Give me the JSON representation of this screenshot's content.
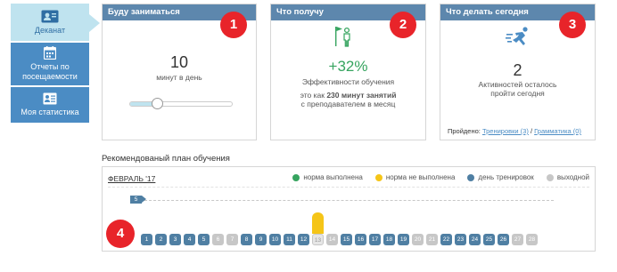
{
  "sidebar": {
    "items": [
      {
        "label": "Деканат",
        "icon": "id-card-icon",
        "active": true
      },
      {
        "label": "Отчеты по посещаемости",
        "icon": "calendar-icon",
        "active": false
      },
      {
        "label": "Моя статистика",
        "icon": "profile-card-icon",
        "active": false
      }
    ]
  },
  "cards": {
    "goal": {
      "title": "Буду заниматься",
      "badge": "1",
      "value": "10",
      "unit": "минут в день",
      "slider_fraction": 0.26
    },
    "result": {
      "title": "Что получу",
      "badge": "2",
      "icon": "flag-person-icon",
      "percent": "+32%",
      "percent_label": "Эффективности обучения",
      "detail_prefix": "это как ",
      "detail_bold": "230 минут занятий",
      "detail_suffix": "с преподавателем в месяц"
    },
    "today": {
      "title": "Что делать сегодня",
      "badge": "3",
      "icon": "running-person-icon",
      "value": "2",
      "label": "Активностей осталось пройти сегодня",
      "passed_label": "Пройдено:",
      "link_training": "Тренировки (3)",
      "link_separator": "/",
      "link_grammar": "Грамматика (0)"
    }
  },
  "plan": {
    "title": "Рекомендованый план обучения",
    "month": "ФЕВРАЛЬ '17",
    "week_marker": "5",
    "badge": "4",
    "legend": [
      {
        "label": "норма выполнена",
        "color": "#36a45f"
      },
      {
        "label": "норма не выполнена",
        "color": "#f5c518"
      },
      {
        "label": "день тренировок",
        "color": "#4f7fa3"
      },
      {
        "label": "выходной",
        "color": "#c7c7c7"
      }
    ],
    "colors": {
      "train": "#4f7fa3",
      "off": "#c7c7c7",
      "accent_red": "#e8242a",
      "header_blue": "#5d87ad"
    },
    "days": [
      {
        "n": "1",
        "type": "train"
      },
      {
        "n": "2",
        "type": "train"
      },
      {
        "n": "3",
        "type": "train"
      },
      {
        "n": "4",
        "type": "train"
      },
      {
        "n": "5",
        "type": "train"
      },
      {
        "n": "6",
        "type": "off"
      },
      {
        "n": "7",
        "type": "off"
      },
      {
        "n": "8",
        "type": "train"
      },
      {
        "n": "9",
        "type": "train"
      },
      {
        "n": "10",
        "type": "train"
      },
      {
        "n": "11",
        "type": "train"
      },
      {
        "n": "12",
        "type": "train"
      },
      {
        "n": "13",
        "type": "current",
        "unmet": true
      },
      {
        "n": "14",
        "type": "off"
      },
      {
        "n": "15",
        "type": "train"
      },
      {
        "n": "16",
        "type": "train"
      },
      {
        "n": "17",
        "type": "train"
      },
      {
        "n": "18",
        "type": "train"
      },
      {
        "n": "19",
        "type": "train"
      },
      {
        "n": "20",
        "type": "off"
      },
      {
        "n": "21",
        "type": "off"
      },
      {
        "n": "22",
        "type": "train"
      },
      {
        "n": "23",
        "type": "train"
      },
      {
        "n": "24",
        "type": "train"
      },
      {
        "n": "25",
        "type": "train"
      },
      {
        "n": "26",
        "type": "train"
      },
      {
        "n": "27",
        "type": "off"
      },
      {
        "n": "28",
        "type": "off"
      }
    ]
  }
}
